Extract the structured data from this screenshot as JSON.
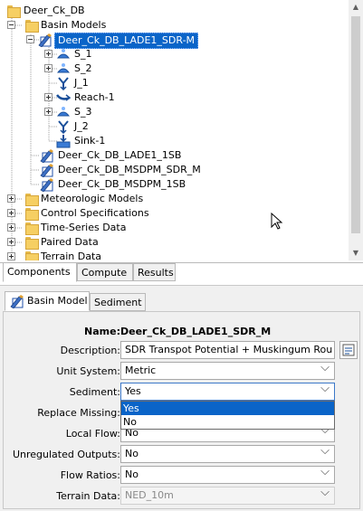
{
  "tree": {
    "root_label": "Deer_Ck_DB",
    "basin_models_label": "Basin Models",
    "selected_model": "Deer_Ck_DB_LADE1_SDR-M",
    "elements": [
      "S_1",
      "S_2",
      "J_1",
      "Reach-1",
      "S_3",
      "J_2",
      "Sink-1"
    ],
    "other_models": [
      "Deer_Ck_DB_LADE1_1SB",
      "Deer_Ck_DB_MSDPM_SDR_M",
      "Deer_Ck_DB_MSDPM_1SB"
    ],
    "folders": [
      "Meteorologic Models",
      "Control Specifications",
      "Time-Series Data",
      "Paired Data",
      "Terrain Data"
    ]
  },
  "bottom_tabs": [
    "Components",
    "Compute",
    "Results"
  ],
  "property_tabs": [
    "Basin Model",
    "Sediment"
  ],
  "properties": {
    "name_label": "Name:",
    "name_value": "Deer_Ck_DB_LADE1_SDR_M",
    "description_label": "Description:",
    "description_value": "SDR Transpot Potential + Muskingum Rou",
    "unit_system_label": "Unit System:",
    "unit_system_value": "Metric",
    "sediment_label": "Sediment:",
    "sediment_value": "Yes",
    "sediment_options": [
      "Yes",
      "No"
    ],
    "replace_missing_label": "Replace Missing:",
    "local_flow_label": "Local Flow:",
    "local_flow_value": "No",
    "unregulated_outputs_label": "Unregulated Outputs:",
    "unregulated_outputs_value": "No",
    "flow_ratios_label": "Flow Ratios:",
    "flow_ratios_value": "No",
    "terrain_data_label": "Terrain Data:",
    "terrain_data_value": "NED_10m"
  },
  "colors": {
    "selection": "#0a64c8",
    "folder": "#f6cf63",
    "panel": "#f0f0f0"
  }
}
